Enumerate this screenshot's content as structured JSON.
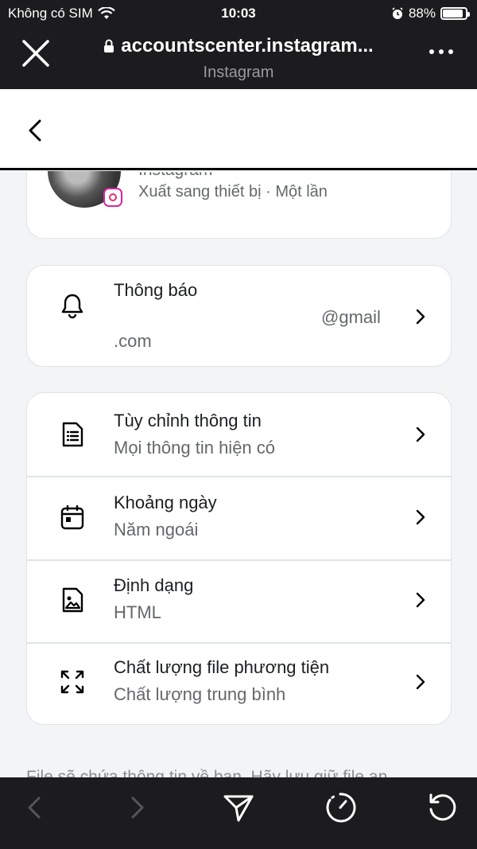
{
  "status_bar": {
    "carrier": "Không có SIM",
    "time": "10:03",
    "battery": "88%"
  },
  "browser": {
    "url": "accountscenter.instagram...",
    "site_name": "Instagram"
  },
  "account_card": {
    "name": "Instagram",
    "subtitle": "Xuất sang thiết bị · Một lần"
  },
  "notify_card": {
    "title": "Thông báo",
    "email_part1": "@gmail",
    "email_part2": ".com"
  },
  "settings": [
    {
      "title": "Tùy chỉnh thông tin",
      "value": "Mọi thông tin hiện có",
      "icon": "document-list-icon"
    },
    {
      "title": "Khoảng ngày",
      "value": "Năm ngoái",
      "icon": "calendar-icon"
    },
    {
      "title": "Định dạng",
      "value": "HTML",
      "icon": "image-file-icon"
    },
    {
      "title": "Chất lượng file phương tiện",
      "value": "Chất lượng trung bình",
      "icon": "expand-arrows-icon"
    }
  ],
  "footer_text": "File sẽ chứa thông tin về bạn. Hãy lưu giữ file an",
  "colors": {
    "chrome": "#1c1c1e",
    "page_bg": "#f2f4f6",
    "card_border": "#dfe3e8",
    "secondary_text": "#65676b"
  }
}
